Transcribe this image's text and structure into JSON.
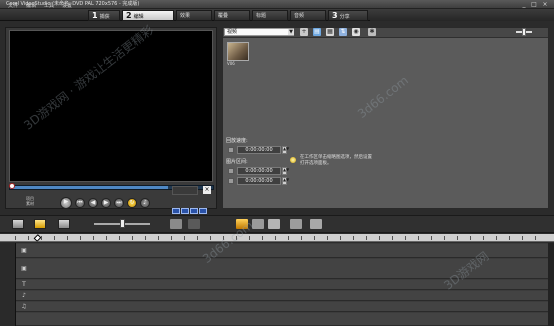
{
  "window": {
    "title": "Corel VideoStudio (未命名, DVD PAL 720x576 - 完成版)",
    "buttons": [
      "_",
      "□",
      "×"
    ]
  },
  "menu": {
    "items": [
      "文件",
      "编辑",
      "工具",
      "设置"
    ]
  },
  "steps": [
    {
      "num": "1",
      "label": "捕获",
      "active": false
    },
    {
      "num": "2",
      "label": "编辑",
      "active": true
    },
    {
      "num": "",
      "label": "效果",
      "active": false
    },
    {
      "num": "",
      "label": "覆叠",
      "active": false
    },
    {
      "num": "",
      "label": "标题",
      "active": false
    },
    {
      "num": "",
      "label": "音频",
      "active": false
    },
    {
      "num": "3",
      "label": "分享",
      "active": false
    }
  ],
  "preview": {
    "play_mode_label": "项目",
    "play_mode_sub": "素材",
    "timecode": "",
    "controls": [
      "play-button",
      "home-button",
      "prev-frame-button",
      "next-frame-button",
      "end-button",
      "repeat-button",
      "volume-button"
    ]
  },
  "library": {
    "category": "视频",
    "thumb_label": "V06"
  },
  "options": {
    "trim_start_label": "回放速度:",
    "duration_label": "图片区间:",
    "tc1": "0:00:00:00",
    "tc2": "0:00:00:00",
    "tc3": "0:00:00:00",
    "tc4": "0:00:00:00",
    "hint_line1": "在工作区单击缩略图选项，然后设置",
    "hint_line2": "打开选项面板。"
  },
  "watermarks": [
    "3D游戏网 · 游戏让生活更精彩",
    "3d66.com",
    "3d66.com",
    "3D游戏网"
  ]
}
